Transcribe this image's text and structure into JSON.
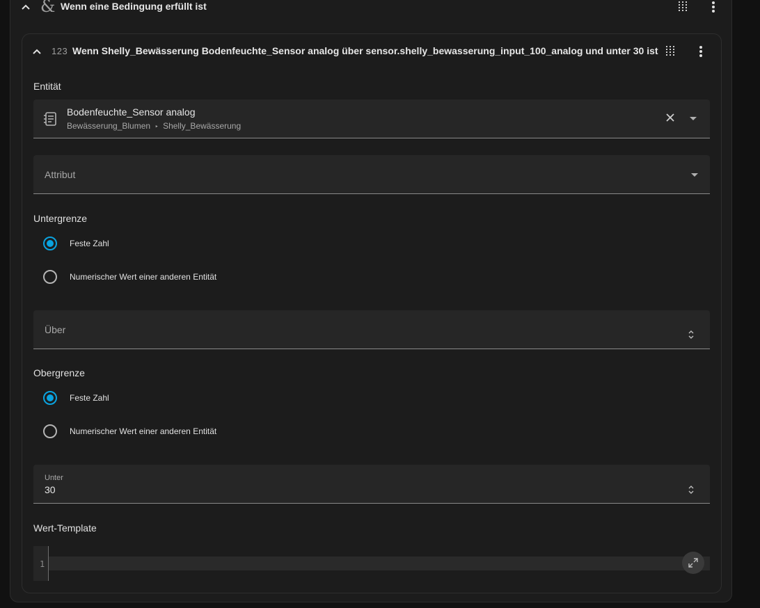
{
  "outer": {
    "title": "Wenn eine Bedingung erfüllt ist",
    "icon": "ampersand-icon",
    "symbol": "&"
  },
  "condition": {
    "type_label": "123",
    "title": "Wenn Shelly_Bewässerung Bodenfeuchte_Sensor analog über sensor.shelly_bewasserung_input_100_analog und unter 30 ist"
  },
  "entity": {
    "label": "Entität",
    "name": "Bodenfeuchte_Sensor analog",
    "area": "Bewässerung_Blumen",
    "separator": "‣",
    "device": "Shelly_Bewässerung"
  },
  "attribute": {
    "placeholder": "Attribut"
  },
  "lower": {
    "label": "Untergrenze",
    "options": [
      "Feste Zahl",
      "Numerischer Wert einer anderen Entität"
    ],
    "selected": 0,
    "field_label": "Über",
    "value": ""
  },
  "upper": {
    "label": "Obergrenze",
    "options": [
      "Feste Zahl",
      "Numerischer Wert einer anderen Entität"
    ],
    "selected": 0,
    "field_label": "Unter",
    "value": "30"
  },
  "template": {
    "label": "Wert-Template",
    "line_number": "1"
  },
  "colors": {
    "accent": "#0aa3df",
    "background": "#1c1c1c",
    "field": "#262626"
  }
}
